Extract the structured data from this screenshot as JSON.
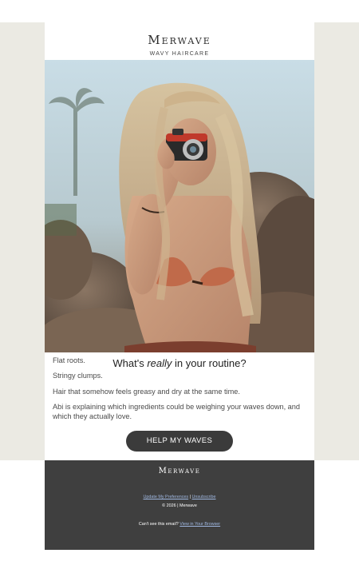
{
  "header": {
    "brand": "Merwave",
    "tagline": "WAVY HAIRCARE"
  },
  "hero": {
    "alt": "Woman with long wavy hair taking a photo with a camera on rocky beach"
  },
  "main": {
    "headline_pre": "What's ",
    "headline_em": "really",
    "headline_post": " in your routine?",
    "paragraphs": [
      "Flat roots.",
      "Stringy clumps.",
      "Hair that somehow feels greasy and dry at the same time.",
      "Abi is explaining which ingredients could be weighing your waves down, and which they actually love."
    ],
    "cta_label": "HELP MY WAVES"
  },
  "footer": {
    "brand": "Merwave",
    "update_prefs": "Update My Preferences",
    "separator": "|",
    "unsubscribe": "Unsubscribe",
    "copyright": "© 2026 | Merwave",
    "cant_see": "Can't see this email?",
    "view_browser": "View in Your Browser"
  },
  "colors": {
    "band": "#ebeae3",
    "button": "#3b3b3b",
    "footer": "#3f3f3f",
    "link": "#9fb7e0"
  }
}
